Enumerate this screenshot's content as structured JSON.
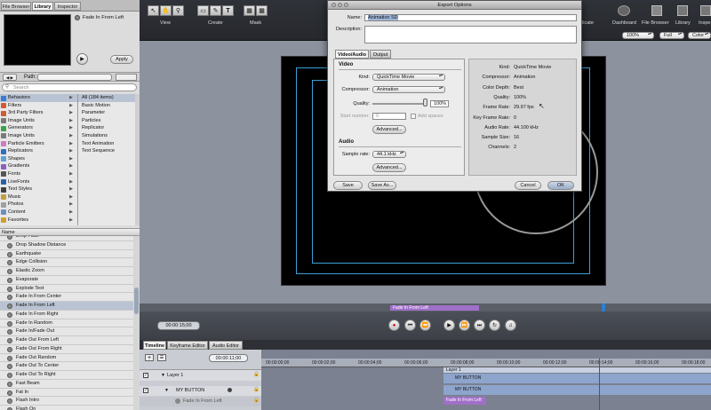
{
  "top_tabs": [
    "File Browser",
    "Library",
    "Inspector"
  ],
  "preview": {
    "title": "Fade In From Left",
    "apply_label": "Apply"
  },
  "path": {
    "label": "Path:"
  },
  "search": {
    "placeholder": "Search"
  },
  "categories": [
    {
      "label": "Behaviors",
      "color": "#3a7bd5"
    },
    {
      "label": "Filters",
      "color": "#cf5a35"
    },
    {
      "label": "3rd Party Filters",
      "color": "#cf5a35"
    },
    {
      "label": "Image Units",
      "color": "#7a7a7a"
    },
    {
      "label": "Generators",
      "color": "#3aa24a"
    },
    {
      "label": "Image Units",
      "color": "#7a7a7a"
    },
    {
      "label": "Particle Emitters",
      "color": "#d07ac4"
    },
    {
      "label": "Replicators",
      "color": "#2f6fc0"
    },
    {
      "label": "Shapes",
      "color": "#5fa3d6"
    },
    {
      "label": "Gradients",
      "color": "#8a5fc0"
    },
    {
      "label": "Fonts",
      "color": "#555555"
    },
    {
      "label": "LiveFonts",
      "color": "#2a5fa8"
    },
    {
      "label": "Text Styles",
      "color": "#3f3f3f"
    },
    {
      "label": "Music",
      "color": "#c0a040"
    },
    {
      "label": "Photos",
      "color": "#a0a0a0"
    },
    {
      "label": "Content",
      "color": "#6c8fbf"
    },
    {
      "label": "Favorites",
      "color": "#d0a030"
    }
  ],
  "subcategories": [
    "All (184 items)",
    "Basic Motion",
    "Parameter",
    "Particles",
    "Replicator",
    "Simulations",
    "Text Animation",
    "Text Sequence"
  ],
  "list_header": "Name",
  "behaviors": [
    "Drop Fade",
    "Drop Shadow Distance",
    "Earthquake",
    "Edge Collision",
    "Elastic Zoom",
    "Evaporate",
    "Explode Text",
    "Fade In From Center",
    "Fade In From Left",
    "Fade In From Right",
    "Fade In Random",
    "Fade In/Fade Out",
    "Fade Out From Left",
    "Fade Out From Right",
    "Fade Out Random",
    "Fade Out To Center",
    "Fade Out To Right",
    "Fast Beam",
    "Fat In",
    "Flash Intro",
    "Flash On"
  ],
  "selected_behavior": "Fade In From Left",
  "toolbar": {
    "groups": [
      "View",
      "Create",
      "Mask"
    ],
    "right_labels": [
      "plicate",
      "Dashboard",
      "File Browser",
      "Library",
      "Inspe"
    ],
    "zoom": "100%",
    "resolution": "Full",
    "color": "Color"
  },
  "canvas": {
    "timebar_label": "Fade In From Left"
  },
  "transport": {
    "timecode": "00:00:15;00"
  },
  "timeline": {
    "tabs": [
      "Timeline",
      "Keyframe Editor",
      "Audio Editor"
    ],
    "timecode": "00:00:11;00",
    "ruler": [
      "00:00:00;00",
      "00:00:02;00",
      "00:00:04;00",
      "00:00:06;00",
      "00:00:08;00",
      "00:00:10;00",
      "00:00:12;00",
      "00:00:14;00",
      "00:00:16;00",
      "00:00:18;00"
    ],
    "layers": [
      {
        "name": "Layer 1"
      },
      {
        "name": "MY BUTTON"
      },
      {
        "name": "Fade In From Left"
      }
    ],
    "tracks": [
      "Layer 1",
      "MY BUTTON",
      "MY BUTTON",
      "Fade In From Left"
    ]
  },
  "dialog": {
    "title": "Export Options",
    "name_label": "Name:",
    "name_value": "Animation SD",
    "description_label": "Description:",
    "tabs": [
      "Video/Audio",
      "Output"
    ],
    "video_heading": "Video",
    "kind_label": "Kind:",
    "kind_value": "QuickTime Movie",
    "compressor_label": "Compressor:",
    "compressor_value": "Animation",
    "quality_label": "Quality:",
    "quality_value": "100%",
    "start_number_label": "Start number:",
    "start_number_value": "0",
    "add_spaces_label": "Add spaces",
    "advanced_label": "Advanced...",
    "audio_heading": "Audio",
    "sample_rate_label": "Sample rate:",
    "sample_rate_value": "44.1 kHz",
    "advanced2_label": "Advanced...",
    "info": [
      {
        "k": "Kind:",
        "v": "QuickTime Movie"
      },
      {
        "k": "Compressor:",
        "v": "Animation"
      },
      {
        "k": "Color Depth:",
        "v": "Best"
      },
      {
        "k": "Quality:",
        "v": "100%"
      },
      {
        "k": "Frame Rate:",
        "v": "29.97 fps"
      },
      {
        "k": "Key Frame Rate:",
        "v": "0"
      },
      {
        "k": "Audio Rate:",
        "v": "44.100 kHz"
      },
      {
        "k": "Sample Size:",
        "v": "16"
      },
      {
        "k": "Channels:",
        "v": "2"
      }
    ],
    "save_label": "Save",
    "save_as_label": "Save As...",
    "cancel_label": "Cancel",
    "ok_label": "OK"
  }
}
